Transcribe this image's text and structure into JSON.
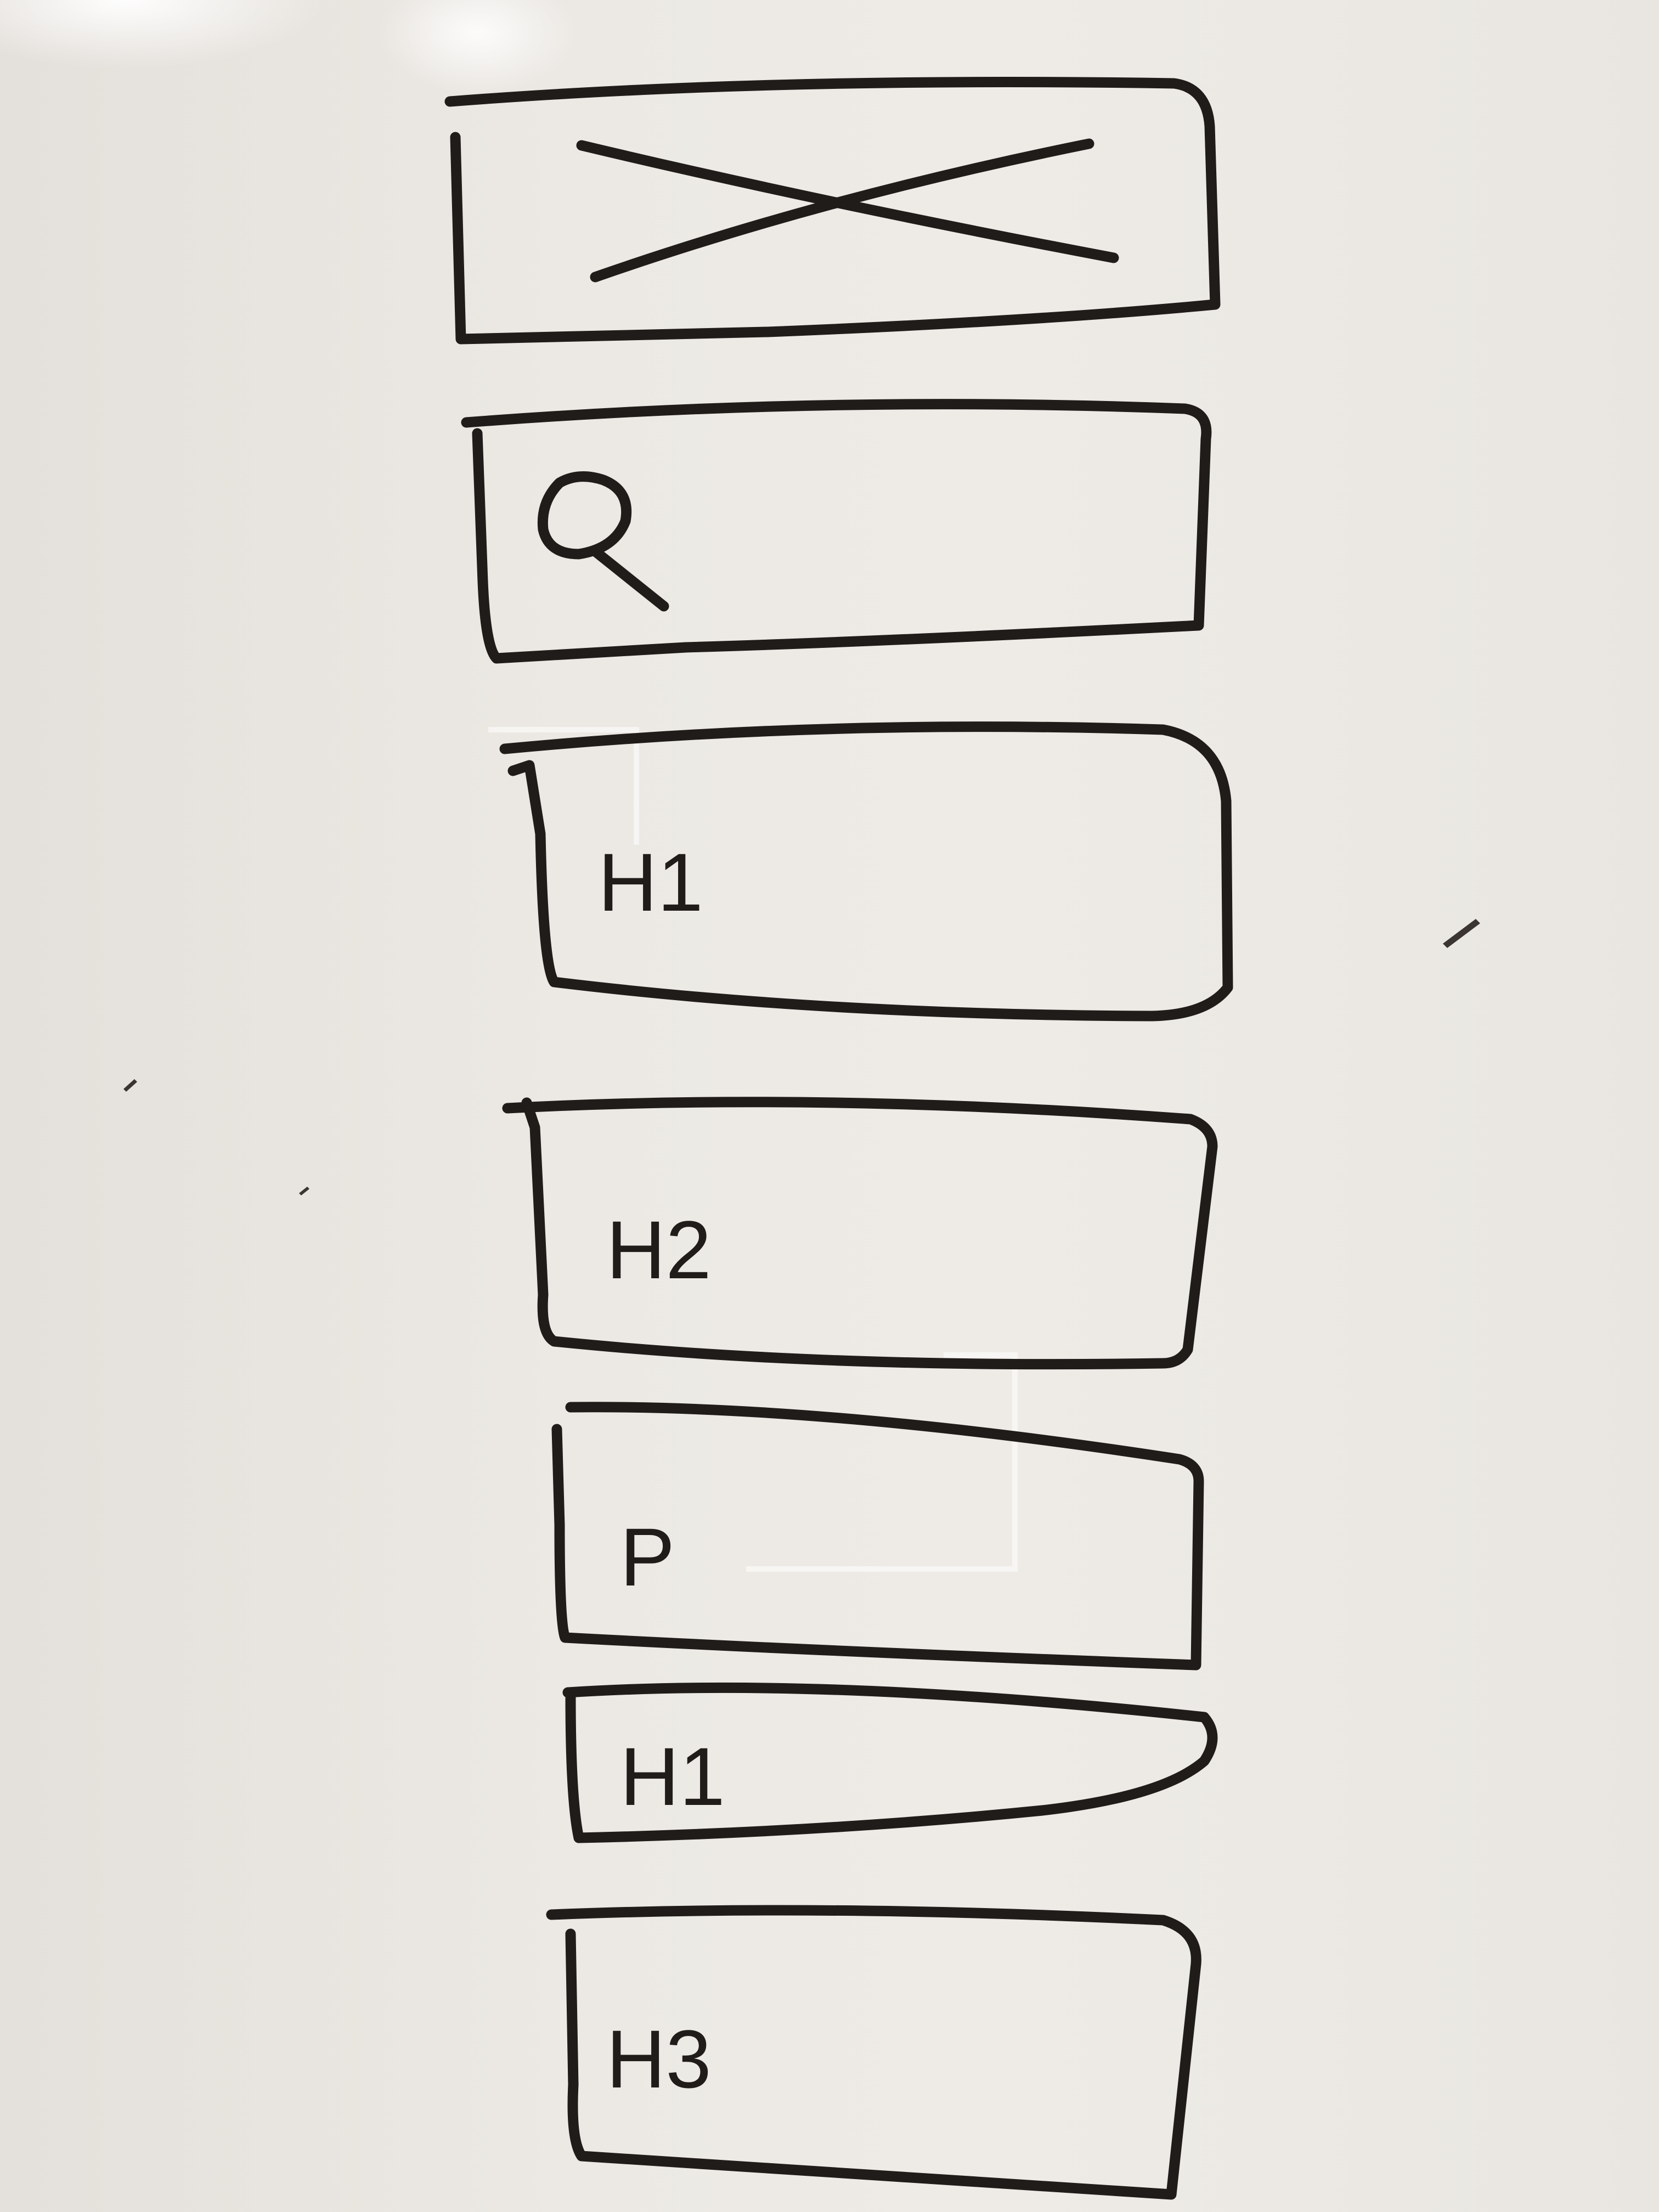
{
  "diagram": {
    "blocks": [
      {
        "id": "image",
        "label": "",
        "icon": "cross-icon"
      },
      {
        "id": "search",
        "label": "",
        "icon": "search-icon"
      },
      {
        "id": "heading-1",
        "label": "H1"
      },
      {
        "id": "heading-2",
        "label": "H2"
      },
      {
        "id": "paragraph",
        "label": "P"
      },
      {
        "id": "heading-1b",
        "label": "H1"
      },
      {
        "id": "heading-3",
        "label": "H3"
      }
    ]
  }
}
